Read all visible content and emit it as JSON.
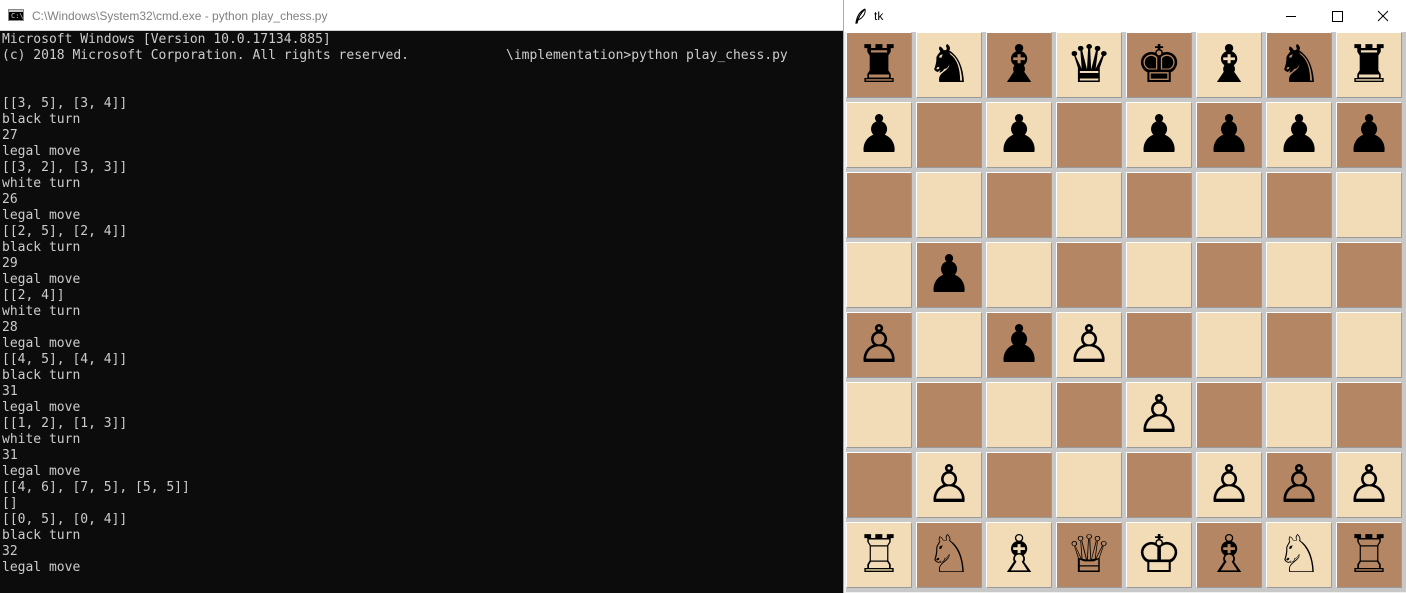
{
  "cmd": {
    "title": "C:\\Windows\\System32\\cmd.exe - python  play_chess.py",
    "icon": "cmd-console-icon",
    "lines": [
      "Microsoft Windows [Version 10.0.17134.885]",
      "(c) 2018 Microsoft Corporation. All rights reserved.",
      "",
      "",
      "[[3, 5], [3, 4]]",
      "black turn",
      "27",
      "legal move",
      "[[3, 2], [3, 3]]",
      "white turn",
      "26",
      "legal move",
      "[[2, 5], [2, 4]]",
      "black turn",
      "29",
      "legal move",
      "[[2, 4]]",
      "white turn",
      "28",
      "legal move",
      "[[4, 5], [4, 4]]",
      "black turn",
      "31",
      "legal move",
      "[[1, 2], [1, 3]]",
      "white turn",
      "31",
      "legal move",
      "[[4, 6], [7, 5], [5, 5]]",
      "[]",
      "[[0, 5], [0, 4]]",
      "black turn",
      "32",
      "legal move"
    ],
    "prompt": "\\implementation>python play_chess.py"
  },
  "tk": {
    "title": "tk",
    "feather_icon": "feather-icon",
    "buttons": {
      "minimize": "minimize-icon",
      "maximize": "maximize-icon",
      "close": "close-icon"
    }
  },
  "board": {
    "light_color": "#f2dcb8",
    "dark_color": "#b58663",
    "rows": [
      {
        "colors": [
          "D",
          "L",
          "D",
          "L",
          "D",
          "L",
          "D",
          "L"
        ],
        "pieces": [
          "♜",
          "♞",
          "♝",
          "♛",
          "♚",
          "♝",
          "♞",
          "♜"
        ],
        "sides": [
          "b",
          "b",
          "b",
          "b",
          "b",
          "b",
          "b",
          "b"
        ]
      },
      {
        "colors": [
          "L",
          "D",
          "L",
          "D",
          "L",
          "D",
          "L",
          "D"
        ],
        "pieces": [
          "♟",
          "",
          "♟",
          "",
          "♟",
          "♟",
          "♟",
          "♟"
        ],
        "sides": [
          "b",
          "",
          "b",
          "",
          "b",
          "b",
          "b",
          "b"
        ]
      },
      {
        "colors": [
          "D",
          "L",
          "D",
          "L",
          "D",
          "L",
          "D",
          "L"
        ],
        "pieces": [
          "",
          "",
          "",
          "",
          "",
          "",
          "",
          ""
        ],
        "sides": [
          "",
          "",
          "",
          "",
          "",
          "",
          "",
          ""
        ]
      },
      {
        "colors": [
          "L",
          "D",
          "L",
          "D",
          "L",
          "D",
          "L",
          "D"
        ],
        "pieces": [
          "",
          "♟",
          "",
          "",
          "",
          "",
          "",
          ""
        ],
        "sides": [
          "",
          "b",
          "",
          "",
          "",
          "",
          "",
          ""
        ]
      },
      {
        "colors": [
          "D",
          "L",
          "D",
          "L",
          "D",
          "L",
          "D",
          "L"
        ],
        "pieces": [
          "♙",
          "",
          "♟",
          "♙",
          "",
          "",
          "",
          ""
        ],
        "sides": [
          "w",
          "",
          "b",
          "w",
          "",
          "",
          "",
          ""
        ]
      },
      {
        "colors": [
          "L",
          "D",
          "L",
          "D",
          "L",
          "D",
          "L",
          "D"
        ],
        "pieces": [
          "",
          "",
          "",
          "",
          "♙",
          "",
          "",
          ""
        ],
        "sides": [
          "",
          "",
          "",
          "",
          "w",
          "",
          "",
          ""
        ]
      },
      {
        "colors": [
          "D",
          "L",
          "D",
          "L",
          "D",
          "L",
          "D",
          "L"
        ],
        "pieces": [
          "",
          "♙",
          "",
          "",
          "",
          "♙",
          "♙",
          "♙"
        ],
        "sides": [
          "",
          "w",
          "",
          "",
          "",
          "w",
          "w",
          "w"
        ]
      },
      {
        "colors": [
          "L",
          "D",
          "L",
          "D",
          "L",
          "D",
          "L",
          "D"
        ],
        "pieces": [
          "♖",
          "♘",
          "♗",
          "♕",
          "♔",
          "♗",
          "♘",
          "♖"
        ],
        "sides": [
          "w",
          "w",
          "w",
          "w",
          "w",
          "w",
          "w",
          "w"
        ]
      }
    ]
  }
}
